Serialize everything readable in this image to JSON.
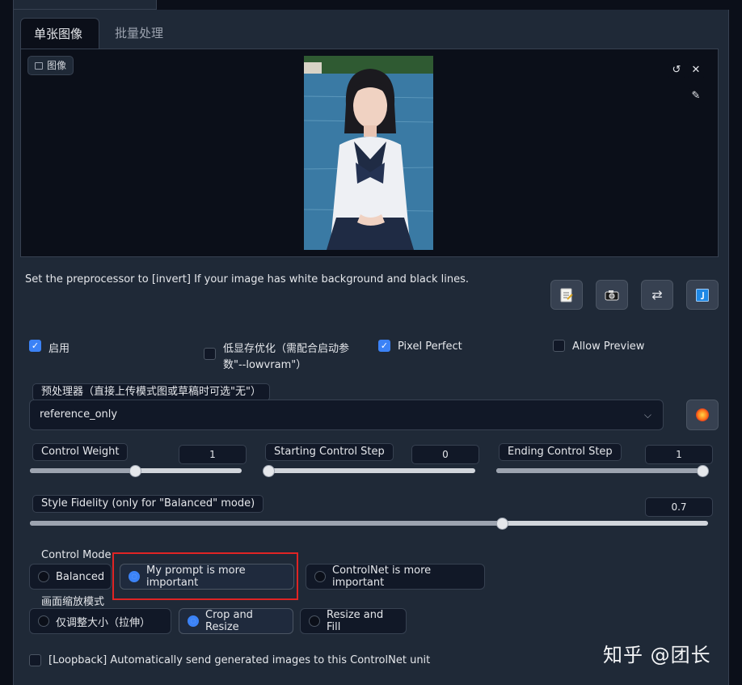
{
  "tabs": {
    "active": "单张图像",
    "inactive": "批量处理"
  },
  "image_panel": {
    "label": "图像"
  },
  "hint": "Set the preprocessor to [invert] If your image has white background and black lines.",
  "toolbar_icons": [
    "new-canvas-icon",
    "camera-icon",
    "swap-icon",
    "send-dimensions-icon"
  ],
  "checkboxes": {
    "enable": {
      "label": "启用",
      "checked": true
    },
    "low_vram_line1": "低显存优化（需配合启动参",
    "low_vram_line2": "数\"--lowvram\"）",
    "low_vram_checked": false,
    "pixel_perfect": {
      "label": "Pixel Perfect",
      "checked": true
    },
    "allow_preview": {
      "label": "Allow Preview",
      "checked": false
    }
  },
  "preprocessor": {
    "label": "预处理器（直接上传模式图或草稿时可选\"无\"）",
    "value": "reference_only"
  },
  "sliders": {
    "control_weight": {
      "label": "Control Weight",
      "value": "1",
      "fraction": 0.5
    },
    "start_step": {
      "label": "Starting Control Step",
      "value": "0",
      "fraction": 0.0
    },
    "end_step": {
      "label": "Ending Control Step",
      "value": "1",
      "fraction": 1.0
    },
    "style_fidelity": {
      "label": "Style Fidelity (only for \"Balanced\" mode)",
      "value": "0.7",
      "fraction": 0.7
    }
  },
  "control_mode": {
    "label": "Control Mode",
    "options": [
      "Balanced",
      "My prompt is more important",
      "ControlNet is more important"
    ],
    "selected": "My prompt is more important"
  },
  "resize_mode": {
    "label": "画面缩放模式",
    "options": [
      "仅调整大小（拉伸）",
      "Crop and Resize",
      "Resize and Fill"
    ],
    "selected": "Crop and Resize"
  },
  "loopback": {
    "label": "[Loopback] Automatically send generated images to this ControlNet unit",
    "checked": false
  },
  "watermark": "知乎 @团长",
  "colors": {
    "accent": "#3b82f6",
    "highlight": "#e02424",
    "panel": "#1f2937",
    "background": "#0b0f19"
  }
}
